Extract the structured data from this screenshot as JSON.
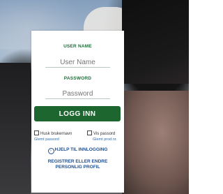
{
  "login": {
    "username_label": "USER NAME",
    "username_placeholder": "User Name",
    "password_label": "PASSWORD",
    "password_placeholder": "Password",
    "login_button": "LOGG INN",
    "remember_username": "Husk brukernavn",
    "show_password": "Vis passord",
    "forgot_password": "Glemt passord",
    "forgot_producer_number": "Glemt prod.nr.",
    "help_login": "HJELP TIL INNLOGGING",
    "register_line1": "REGISTRER ELLER ENDRE",
    "register_line2": "PERSONLIG PROFIL"
  },
  "colors": {
    "brand_green": "#1e6630",
    "label_green": "#1f6b3a",
    "link_blue": "#2a6fb8"
  }
}
